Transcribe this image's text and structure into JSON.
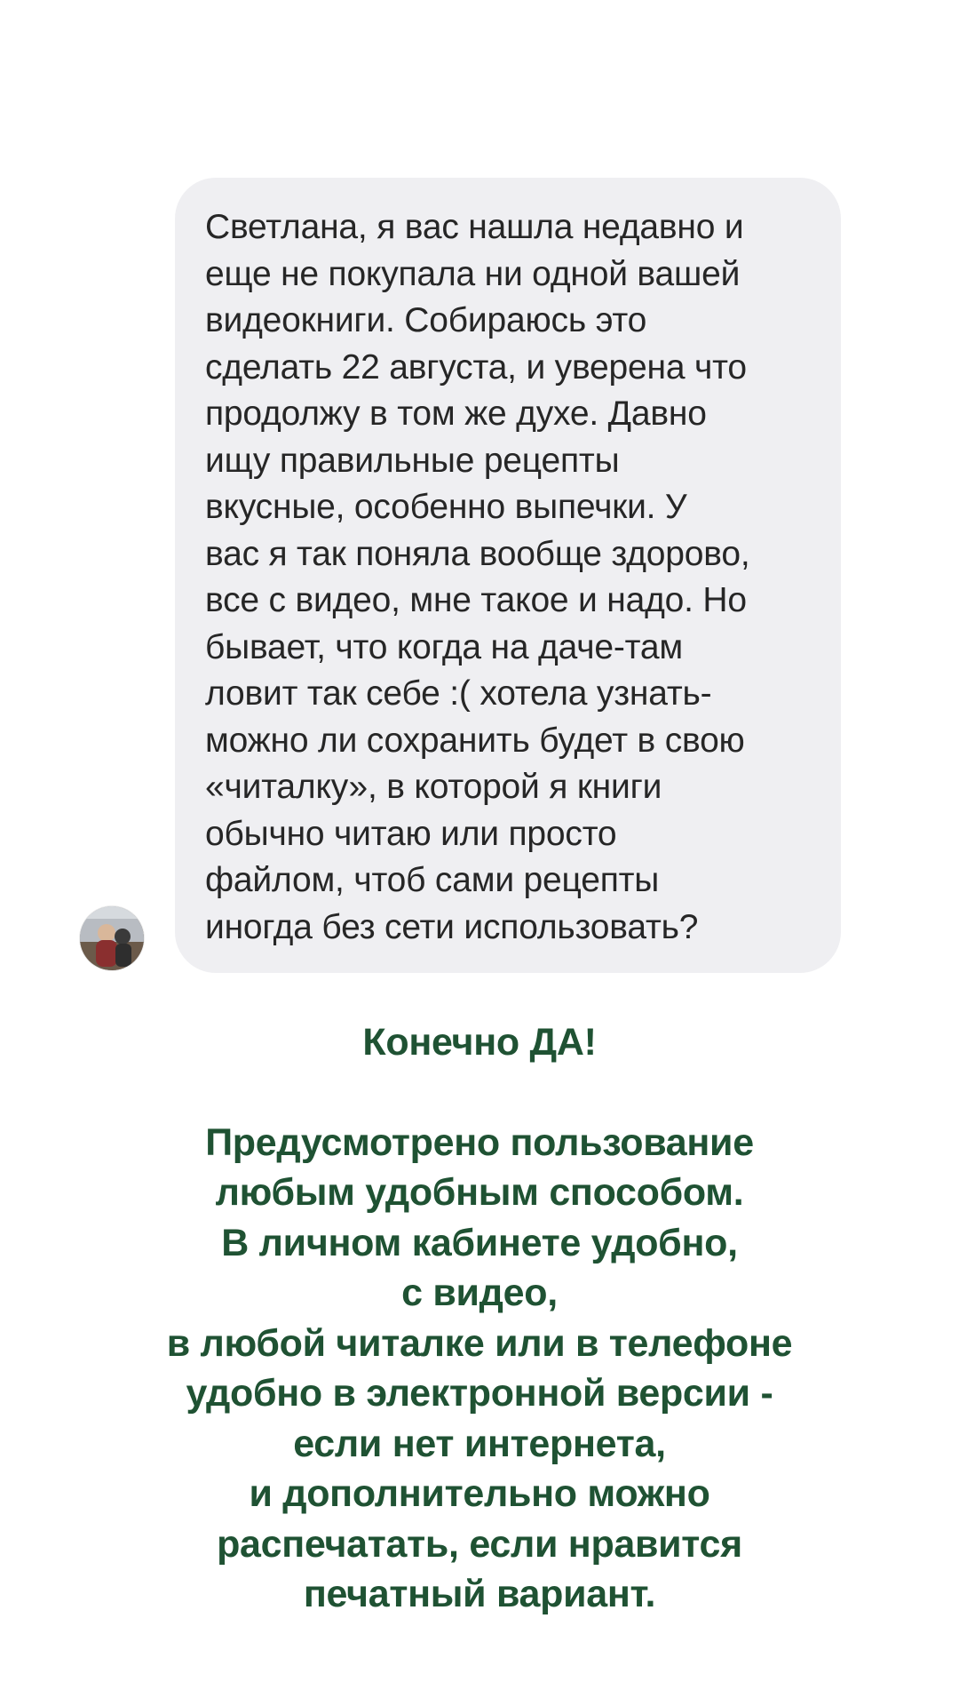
{
  "conversation": {
    "sender_avatar": "avatar-photo",
    "message_lines": [
      "Светлана, я вас нашла недавно и",
      "еще не покупала ни одной вашей",
      "видеокниги. Собираюсь это",
      "сделать 22 августа, и уверена что",
      "продолжу в том же духе. Давно",
      "ищу правильные рецепты",
      "вкусные, особенно выпечки. У",
      "вас я так поняла вообще здорово,",
      "все с видео, мне такое и надо. Но",
      "бывает, что когда на даче-там",
      "ловит так себе :( хотела узнать-",
      "можно ли сохранить будет в свою",
      "«читалку», в которой я книги",
      "обычно читаю или просто",
      "файлом, чтоб сами рецепты",
      "иногда без сети использовать?"
    ]
  },
  "reply": {
    "heading": "Конечно ДА!",
    "lines": [
      "Предусмотрено пользование",
      "любым удобным способом.",
      "В личном кабинете удобно,",
      "с видео,",
      "в любой читалке или в телефоне",
      "удобно в электронной версии -",
      "если нет интернета,",
      "и дополнительно можно",
      "распечатать, если нравится",
      "печатный вариант."
    ],
    "color": "#1f5233"
  },
  "colors": {
    "bubble_background": "#efeff2",
    "message_text": "#262626",
    "page_background": "#ffffff"
  }
}
